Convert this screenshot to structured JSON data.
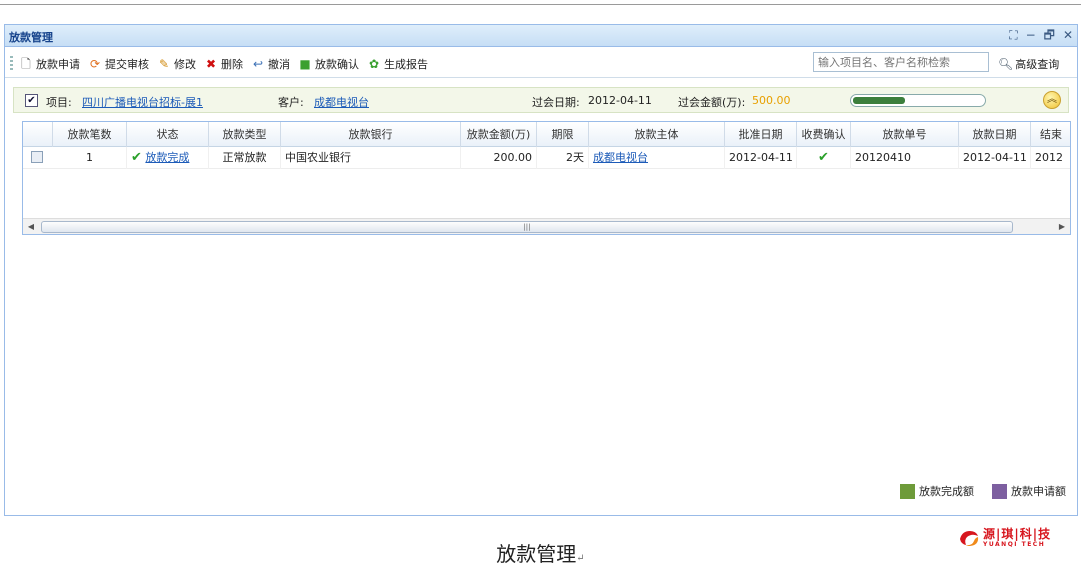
{
  "panel": {
    "title": "放款管理",
    "window_tools": {
      "expand": "⛶",
      "minimize": "−",
      "restore": "🗗",
      "close": "✕"
    }
  },
  "toolbar": {
    "buttons": [
      {
        "label": "放款申请",
        "icon": "document-icon",
        "glyph": "🗋",
        "color": "#555555"
      },
      {
        "label": "提交审核",
        "icon": "refresh-icon",
        "glyph": "⟳",
        "color": "#e07020"
      },
      {
        "label": "修改",
        "icon": "pencil-icon",
        "glyph": "✎",
        "color": "#d08a10"
      },
      {
        "label": "删除",
        "icon": "delete-icon",
        "glyph": "✖",
        "color": "#d01010"
      },
      {
        "label": "撤消",
        "icon": "undo-icon",
        "glyph": "↩",
        "color": "#3a6fb5"
      },
      {
        "label": "放款确认",
        "icon": "confirm-icon",
        "glyph": "■",
        "color": "#3aa030"
      },
      {
        "label": "生成报告",
        "icon": "report-icon",
        "glyph": "✿",
        "color": "#3aa030"
      }
    ],
    "search_placeholder": "输入项目名、客户名称检索",
    "advanced_search_label": "高级查询"
  },
  "project_bar": {
    "checked": true,
    "project_label": "项目:",
    "project_value": "四川广播电视台招标-展1",
    "customer_label": "客户:",
    "customer_value": "成都电视台",
    "meeting_date_label": "过会日期:",
    "meeting_date_value": "2012-04-11",
    "meeting_amount_label": "过会金额(万):",
    "meeting_amount_value": "500.00",
    "progress_fraction": 0.4
  },
  "grid": {
    "columns": [
      "放款笔数",
      "状态",
      "放款类型",
      "放款银行",
      "放款金额(万)",
      "期限",
      "放款主体",
      "批准日期",
      "收费确认",
      "放款单号",
      "放款日期",
      "结束"
    ],
    "rows": [
      {
        "count": "1",
        "status": "放款完成",
        "type": "正常放款",
        "bank": "中国农业银行",
        "amount": "200.00",
        "term": "2天",
        "entity": "成都电视台",
        "approval_date": "2012-04-11",
        "fee_confirmed": true,
        "loan_no": "20120410",
        "loan_date": "2012-04-11",
        "end": "2012"
      }
    ]
  },
  "legend": [
    {
      "label": "放款完成额",
      "color": "#6e9b3a"
    },
    {
      "label": "放款申请额",
      "color": "#7d5fa0"
    }
  ],
  "caption": "放款管理",
  "caption_mark": "↵",
  "logo": {
    "cn": "源|琪|科|技",
    "en": "YUANQI TECH"
  }
}
